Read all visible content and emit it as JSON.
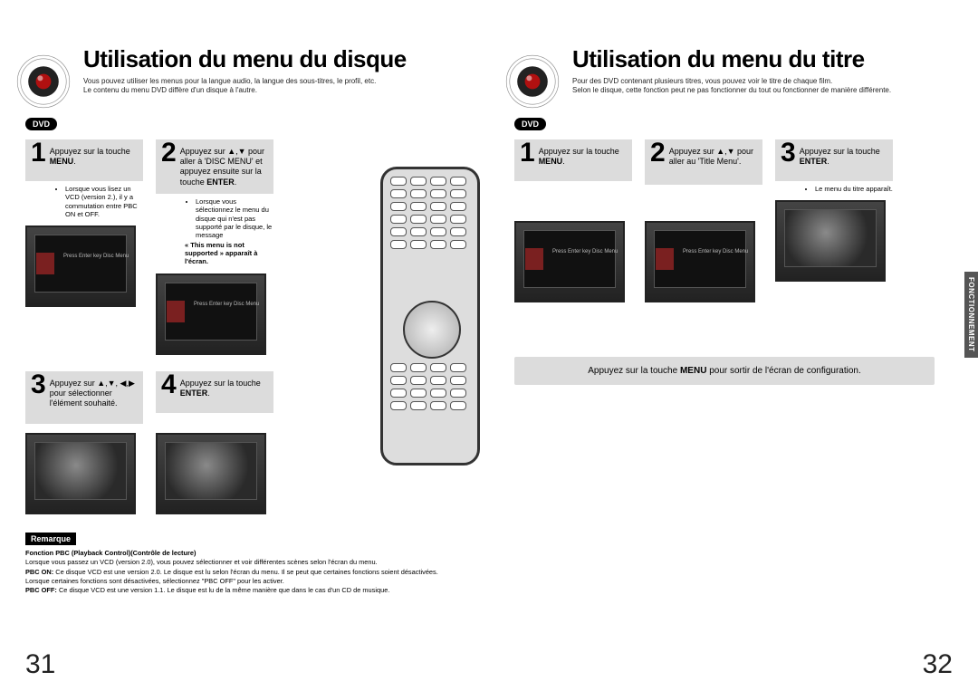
{
  "left": {
    "heading": "Utilisation du menu du disque",
    "intro1": "Vous pouvez utiliser les menus pour la langue audio, la langue des sous-titres, le profil, etc.",
    "intro2": "Le contenu du menu DVD diffère d'un disque à l'autre.",
    "badge": "DVD",
    "step1": {
      "num": "1",
      "text_pre": "Appuyez sur la touche ",
      "bold": "MENU",
      "text_post": "."
    },
    "note1": "Lorsque vous lisez un VCD (version 2.), il y a commutation entre PBC ON et OFF.",
    "step2": {
      "num": "2",
      "text": "Appuyez sur ▲,▼ pour aller à 'DISC MENU' et appuyez ensuite sur la touche ",
      "bold": "ENTER",
      "post": "."
    },
    "note2a": "Lorsque vous sélectionnez le menu du disque qui n'est pas supporté par le disque, le message",
    "note2b": "« This menu is not supported » apparaît à l'écran.",
    "step3": {
      "num": "3",
      "text": "Appuyez sur ▲,▼, ◀,▶ pour sélectionner l'élément souhaité."
    },
    "step4": {
      "num": "4",
      "text": "Appuyez sur la touche ",
      "bold": "ENTER",
      "post": "."
    },
    "remarque_label": "Remarque",
    "remarque_title": "Fonction PBC (Playback Control)(Contrôle de lecture)",
    "remarque_intro": "Lorsque vous passez un VCD (version 2.0), vous pouvez sélectionner et voir différentes scènes selon l'écran du menu.",
    "remarque_on_label": "PBC ON:",
    "remarque_on": "Ce disque VCD est une version 2.0. Le disque est lu selon l'écran du menu. Il se peut que certaines fonctions soient désactivées. Lorsque certaines fonctions sont désactivées, sélectionnez \"PBC OFF\" pour les activer.",
    "remarque_off_label": "PBC OFF:",
    "remarque_off": "Ce disque VCD est une version 1.1. Le disque est lu de la même manière que dans le cas d'un CD de musique.",
    "page_num": "31"
  },
  "right": {
    "heading": "Utilisation du menu du titre",
    "intro1": "Pour des DVD contenant plusieurs titres, vous pouvez voir le titre de chaque film.",
    "intro2": "Selon le disque, cette fonction peut ne pas fonctionner du tout ou fonctionner de manière différente.",
    "badge": "DVD",
    "step1": {
      "num": "1",
      "text": "Appuyez sur la touche ",
      "bold": "MENU",
      "post": "."
    },
    "step2": {
      "num": "2",
      "text": "Appuyez sur ▲,▼ pour aller au 'Title Menu'."
    },
    "step3": {
      "num": "3",
      "text": "Appuyez sur la touche ",
      "bold": "ENTER",
      "post": "."
    },
    "note3": "Le menu du titre apparaît.",
    "exit_pre": "Appuyez sur la touche ",
    "exit_bold": "MENU",
    "exit_post": " pour sortir de l'écran de configuration.",
    "side_tab": "FONCTIONNEMENT",
    "page_num": "32"
  },
  "thumb_menu_lines": "Press Enter key\nDisc Menu"
}
